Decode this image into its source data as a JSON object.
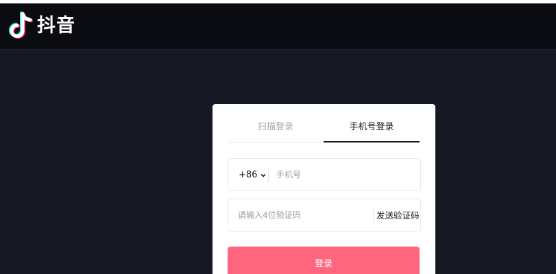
{
  "header": {
    "brand_name": "抖音",
    "logo_icon": "douyin-note-icon"
  },
  "login": {
    "tabs": [
      {
        "label": "扫描登录",
        "active": false
      },
      {
        "label": "手机号登录",
        "active": true
      }
    ],
    "country_code": "+86",
    "phone_placeholder": "手机号",
    "code_placeholder": "请输入4位验证码",
    "send_code_label": "发送验证码",
    "submit_label": "登录"
  },
  "colors": {
    "page_background": "#161823",
    "header_background": "#0b0c12",
    "accent": "#fe6680",
    "logo_cyan": "#25f4ee",
    "logo_red": "#fe2c55"
  }
}
